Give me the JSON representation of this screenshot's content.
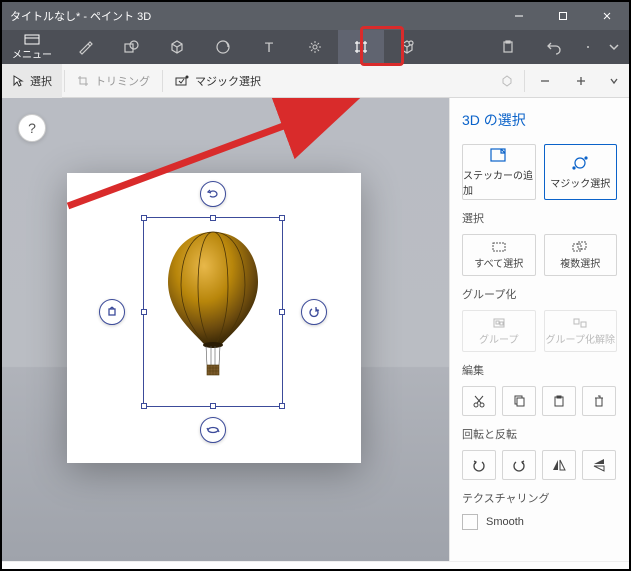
{
  "window": {
    "title": "タイトルなし* - ペイント 3D"
  },
  "toolbar": {
    "menu_label": "メニュー",
    "tools": {
      "brush": "brush",
      "shapes2d": "2d-shapes",
      "shapes3d": "3d-shapes",
      "stickers": "stickers",
      "text": "text",
      "effects": "effects",
      "canvas": "canvas",
      "library": "3d-library",
      "history": "history",
      "undo": "undo",
      "more": "more",
      "expand": "expand"
    }
  },
  "secondbar": {
    "select": "選択",
    "crop": "トリミング",
    "magic": "マジック選択"
  },
  "canvas": {
    "help": "?"
  },
  "panel": {
    "title": "3D の選択",
    "add_sticker": "ステッカーの追加",
    "magic_select": "マジック選択",
    "section_select": "選択",
    "select_all": "すべて選択",
    "multi_select": "複数選択",
    "section_group": "グループ化",
    "group": "グループ",
    "ungroup": "グループ化解除",
    "section_edit": "編集",
    "section_rotate": "回転と反転",
    "section_texture": "テクスチャリング",
    "smooth": "Smooth"
  }
}
